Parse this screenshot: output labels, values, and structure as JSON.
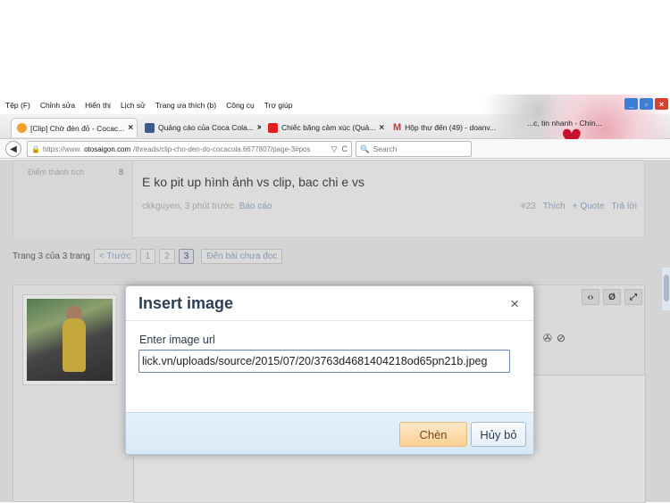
{
  "menu": [
    "Tệp (F)",
    "Chỉnh sửa",
    "Hiển thị",
    "Lịch sử",
    "Trang ưa thích (b)",
    "Công cụ",
    "Trợ giúp"
  ],
  "tabs": [
    {
      "label": "[Clip] Chờ đèn đỏ - Cocac...",
      "color": "#f0a030"
    },
    {
      "label": "Quảng cáo của Coca Cola...",
      "color": "#3a5b8c"
    },
    {
      "label": "Chiếc băng cảm xúc (Quả...",
      "color": "#e02020"
    },
    {
      "label": "Hộp thư đến (49) - doanv...",
      "color": "#d03030"
    }
  ],
  "tab_partial": "...c, tin nhanh - Chín...",
  "address": {
    "prefix": "https://www.",
    "domain": "otosaigon.com",
    "path": "/threads/clip-cho-den-do-cocacola.6677807/page-3#pos"
  },
  "search_placeholder": "Search",
  "post": {
    "stat_label": "Điểm thành tích",
    "stat_value": "8",
    "message": "E ko pit up hình ảnh vs clip, bac chi e vs",
    "author_time": "ckkguyen, 3 phút trước",
    "report": "Báo cáo",
    "number": "#23",
    "like": "Thích",
    "quote": "+ Quote",
    "reply": "Trả lời"
  },
  "pager": {
    "label": "Trang 3 của 3 trang",
    "prev": "< Trước",
    "pages": [
      "1",
      "2",
      "3"
    ],
    "unread": "Đến bài chưa đọc"
  },
  "dialog": {
    "title": "Insert image",
    "close": "×",
    "label": "Enter image url",
    "value": "lick.vn/uploads/source/2015/07/20/3763d4681404218od65pn21b.jpeg",
    "ok": "Chèn",
    "cancel": "Hủy bỏ"
  }
}
